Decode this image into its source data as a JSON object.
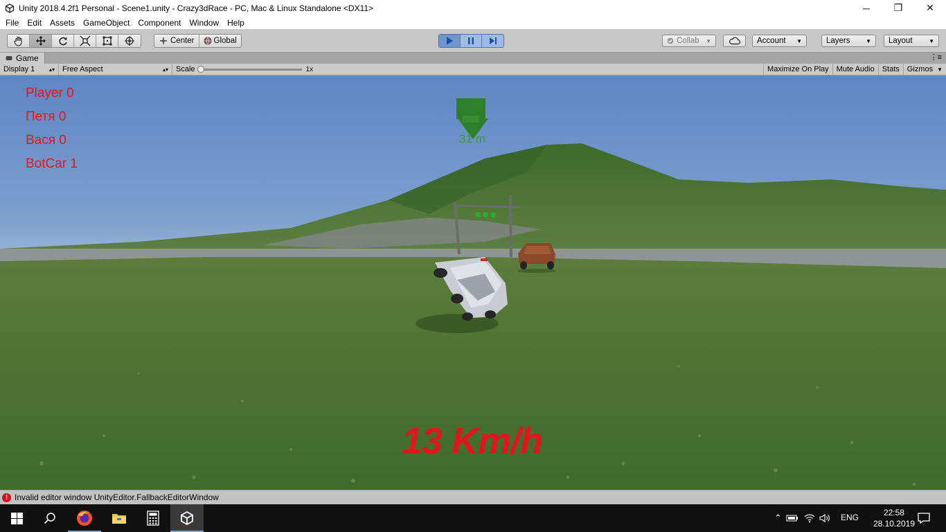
{
  "window": {
    "title": "Unity 2018.4.2f1 Personal - Scene1.unity - Crazy3dRace - PC, Mac & Linux Standalone <DX11>",
    "minimize": "─",
    "restore": "❐",
    "close": "✕"
  },
  "menu": [
    "File",
    "Edit",
    "Assets",
    "GameObject",
    "Component",
    "Window",
    "Help"
  ],
  "toolbar": {
    "tools": [
      "hand-tool",
      "move-tool",
      "rotate-tool",
      "scale-tool",
      "rect-tool",
      "transform-tool"
    ],
    "active_tool": "move-tool",
    "pivot_label": "Center",
    "space_label": "Global",
    "collab_label": "Collab",
    "account_label": "Account",
    "layers_label": "Layers",
    "layout_label": "Layout"
  },
  "game_tab": {
    "label": "Game",
    "display": "Display 1",
    "aspect": "Free Aspect",
    "scale_label": "Scale",
    "scale_value": "1x",
    "maximize_on_play": "Maximize On Play",
    "mute_audio": "Mute Audio",
    "stats": "Stats",
    "gizmos": "Gizmos"
  },
  "game_view": {
    "scores": [
      {
        "text": "Player  0"
      },
      {
        "text": "Петя 0"
      },
      {
        "text": "Вася 0"
      },
      {
        "text": "BotCar 1"
      }
    ],
    "distance": "31 m",
    "speed": "13 Km/h"
  },
  "status": {
    "message": "Invalid editor window UnityEditor.FallbackEditorWindow",
    "icon": "error-icon"
  },
  "taskbar": {
    "apps": [
      "windows-start-icon",
      "search-icon",
      "firefox-icon",
      "file-explorer-icon",
      "calculator-icon",
      "unity-icon"
    ],
    "lang": "ENG",
    "time": "22:58",
    "date": "28.10.2019"
  },
  "colors": {
    "hud_red": "#e8141c",
    "distance_green": "#3a9c2f",
    "play_blue": "#6f95cf"
  }
}
